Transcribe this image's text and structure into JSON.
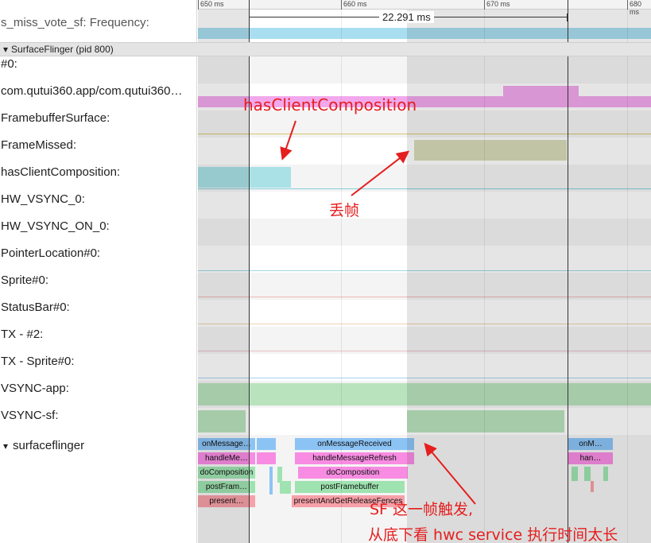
{
  "header": {
    "truncated_track": "s_miss_vote_sf: Frequency:",
    "process_title": "SurfaceFlinger (pid 800)",
    "process_toggle": "▾"
  },
  "ruler": {
    "ticks": [
      "650 ms",
      "660 ms",
      "670 ms",
      "680 ms"
    ],
    "selection_span": "22.291 ms"
  },
  "tracks": [
    "#0:",
    "com.qutui360.app/com.qutui360…",
    "FramebufferSurface:",
    "FrameMissed:",
    "hasClientComposition:",
    "HW_VSYNC_0:",
    "HW_VSYNC_ON_0:",
    "PointerLocation#0:",
    "Sprite#0:",
    "StatusBar#0:",
    "TX - #2:",
    "TX - Sprite#0:",
    "VSYNC-app:",
    "VSYNC-sf:"
  ],
  "thread": {
    "toggle": "▾",
    "name": "surfaceflinger"
  },
  "slices": {
    "left": [
      "onMessage…",
      "handleMe…",
      "doComposition",
      "postFram…",
      "present…"
    ],
    "main": [
      "onMessageReceived",
      "handleMessageRefresh",
      "doComposition",
      "postFramebuffer",
      "presentAndGetReleaseFences"
    ],
    "right": [
      "onM…",
      "han…"
    ]
  },
  "annotations": {
    "has_client": "hasClientComposition",
    "frame_drop": "丢帧",
    "sf_line1": "SF 这一帧触发,",
    "sf_line2": "从底下看 hwc service 执行时间太长"
  },
  "colors": {
    "annotation": "#e51e1e",
    "selection_bg": "#ffffff",
    "outside_shade": "#b0b0b0",
    "vsync_green": "#b9e3bd",
    "hwc_cyan": "#a9e1e6",
    "composition_pink": "#f2a8ec",
    "frame_missed": "#d9dcb8",
    "slice_blue": "#8cc3f5",
    "slice_magenta": "#f78ce2",
    "slice_green": "#9fe3b0",
    "slice_red": "#f7a0a8"
  }
}
